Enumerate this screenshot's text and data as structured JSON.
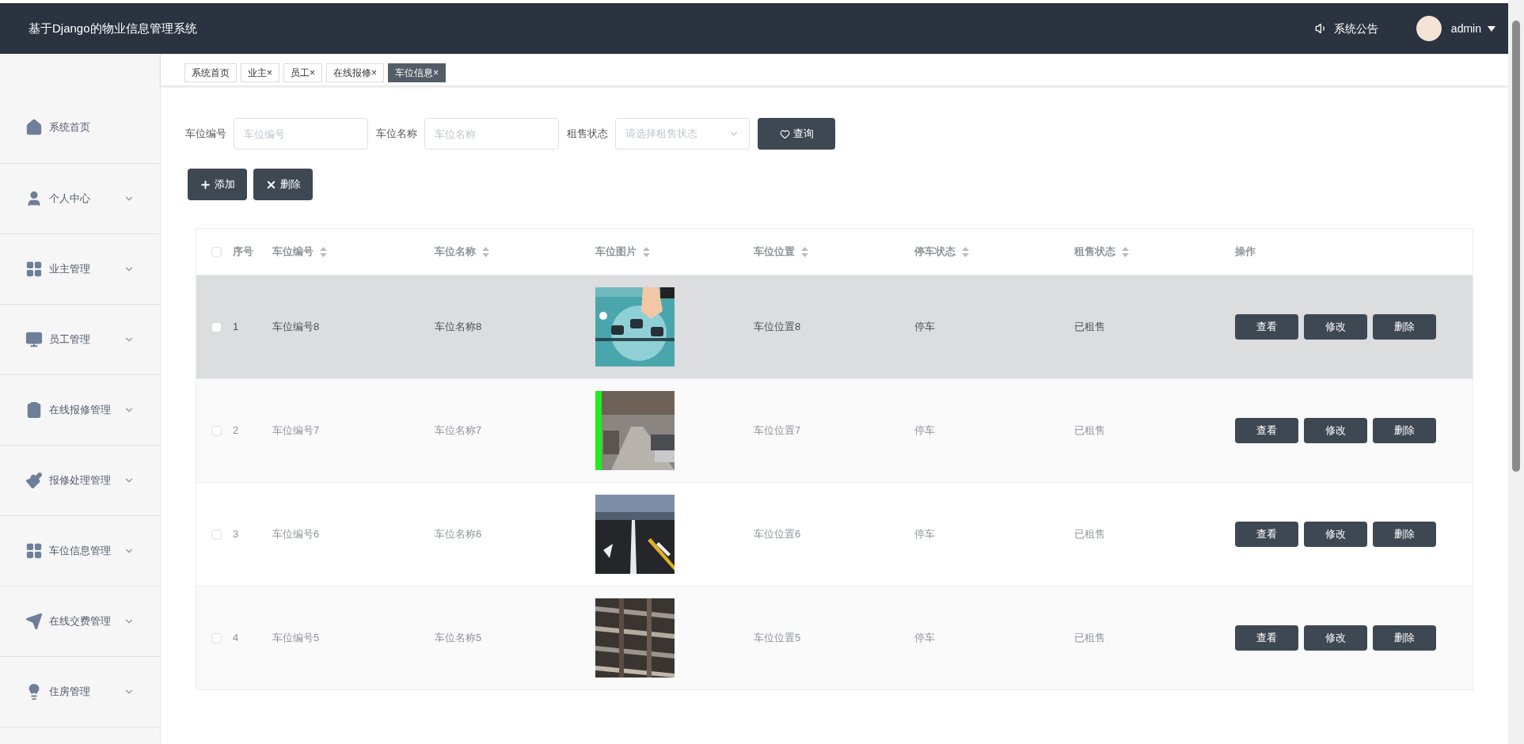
{
  "header": {
    "title": "基于Django的物业信息管理系统",
    "notice": "系统公告",
    "user": "admin"
  },
  "sidebar": {
    "items": [
      {
        "label": "系统首页",
        "kind": "home",
        "expandable": false
      },
      {
        "label": "个人中心",
        "kind": "user",
        "expandable": true
      },
      {
        "label": "业主管理",
        "kind": "grid",
        "expandable": true
      },
      {
        "label": "员工管理",
        "kind": "monitor",
        "expandable": true
      },
      {
        "label": "在线报修管理",
        "kind": "clipboard",
        "expandable": true
      },
      {
        "label": "报修处理管理",
        "kind": "brush",
        "expandable": true
      },
      {
        "label": "车位信息管理",
        "kind": "grid",
        "expandable": true
      },
      {
        "label": "在线交费管理",
        "kind": "plane",
        "expandable": true
      },
      {
        "label": "住房管理",
        "kind": "bulb",
        "expandable": true
      }
    ]
  },
  "tabs": [
    {
      "label": "系统首页",
      "closable": false,
      "selected": false
    },
    {
      "label": "业主",
      "closable": true,
      "selected": false
    },
    {
      "label": "员工",
      "closable": true,
      "selected": false
    },
    {
      "label": "在线报修",
      "closable": true,
      "selected": false
    },
    {
      "label": "车位信息",
      "closable": true,
      "selected": true
    }
  ],
  "close_glyph": "×",
  "search": {
    "fields": [
      {
        "label": "车位编号",
        "placeholder": "车位编号",
        "kind": "text"
      },
      {
        "label": "车位名称",
        "placeholder": "车位名称",
        "kind": "text"
      },
      {
        "label": "租售状态",
        "placeholder": "请选择租售状态",
        "kind": "select"
      }
    ],
    "button": "查询"
  },
  "actions": [
    {
      "label": "添加",
      "kind": "add"
    },
    {
      "label": "删除",
      "kind": "delete"
    }
  ],
  "table": {
    "select_all": {
      "checked": false
    },
    "columns": [
      {
        "label": "序号",
        "kind": "plain"
      },
      {
        "label": "车位编号",
        "kind": "sortable"
      },
      {
        "label": "车位名称",
        "kind": "sortable"
      },
      {
        "label": "车位图片",
        "kind": "sortable"
      },
      {
        "label": "车位位置",
        "kind": "sortable"
      },
      {
        "label": "停车状态",
        "kind": "sortable"
      },
      {
        "label": "租售状态",
        "kind": "sortable"
      },
      {
        "label": "操作",
        "kind": "plain"
      }
    ],
    "rows": [
      {
        "index": "1",
        "code": "车位编号8",
        "name": "车位名称8",
        "location": "车位位置8",
        "parking": "停车",
        "rental": "已租售",
        "selected": true,
        "checked": false,
        "buttons": [
          "查看",
          "修改",
          "删除"
        ]
      },
      {
        "index": "2",
        "code": "车位编号7",
        "name": "车位名称7",
        "location": "车位位置7",
        "parking": "停车",
        "rental": "已租售",
        "selected": false,
        "checked": false,
        "buttons": [
          "查看",
          "修改",
          "删除"
        ]
      },
      {
        "index": "3",
        "code": "车位编号6",
        "name": "车位名称6",
        "location": "车位位置6",
        "parking": "停车",
        "rental": "已租售",
        "selected": false,
        "checked": false,
        "buttons": [
          "查看",
          "修改",
          "删除"
        ]
      },
      {
        "index": "4",
        "code": "车位编号5",
        "name": "车位名称5",
        "location": "车位位置5",
        "parking": "停车",
        "rental": "已租售",
        "selected": false,
        "checked": false,
        "buttons": [
          "查看",
          "修改",
          "删除"
        ]
      }
    ]
  }
}
